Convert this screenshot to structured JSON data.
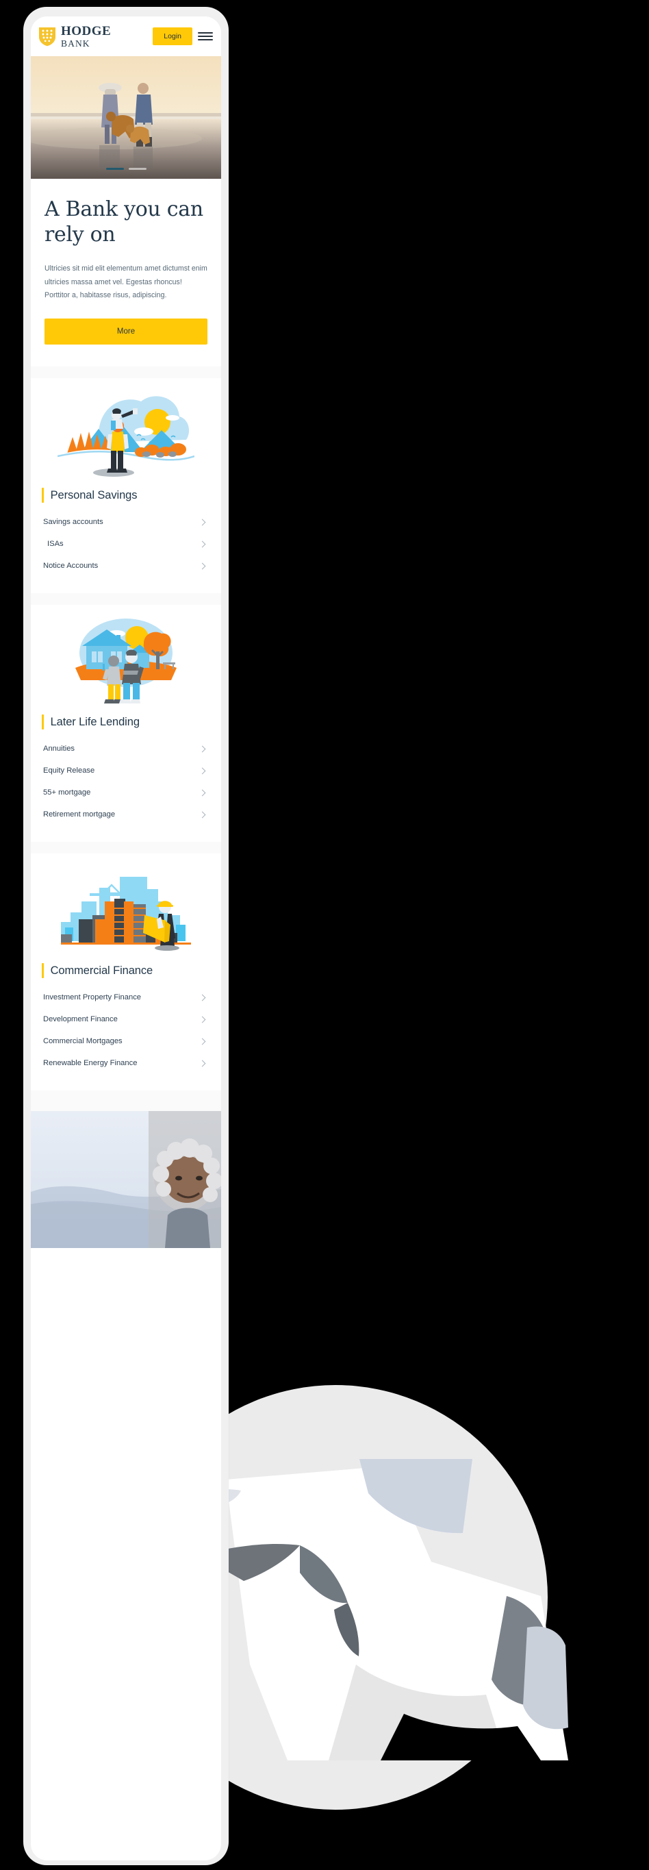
{
  "brand": {
    "name_line1": "HODGE",
    "name_line2": "BANK",
    "logo_icon": "hodge-shield-logo",
    "accent_yellow": "#ffc907",
    "ink_navy": "#23384a"
  },
  "header": {
    "login_label": "Login",
    "menu_icon": "hamburger-menu-icon"
  },
  "hero": {
    "image_alt": "beach-couple-with-dogs-at-sunset",
    "slides_total": 2,
    "active_slide": 1,
    "title": "A Bank you can rely on",
    "paragraph": "Ultricies sit mid elit elementum amet dictumst enim ultricies massa amet vel. Egestas rhoncus! Porttitor a, habitasse risus, adipiscing.",
    "cta_label": "More"
  },
  "sections": [
    {
      "id": "personal-savings",
      "title": "Personal Savings",
      "illustration": "hiker-with-child-and-telescope-illustration",
      "links": [
        {
          "label": "Savings accounts",
          "indent": false
        },
        {
          "label": "ISAs",
          "indent": true
        },
        {
          "label": "Notice Accounts",
          "indent": false
        }
      ]
    },
    {
      "id": "later-life-lending",
      "title": "Later Life Lending",
      "illustration": "couple-walking-past-house-illustration",
      "links": [
        {
          "label": "Annuities",
          "indent": false
        },
        {
          "label": "Equity Release",
          "indent": false
        },
        {
          "label": "55+ mortgage",
          "indent": false
        },
        {
          "label": "Retirement mortgage",
          "indent": false
        }
      ]
    },
    {
      "id": "commercial-finance",
      "title": "Commercial Finance",
      "illustration": "construction-site-with-architect-illustration",
      "links": [
        {
          "label": "Investment Property Finance",
          "indent": false
        },
        {
          "label": "Development Finance",
          "indent": false
        },
        {
          "label": "Commercial Mortgages",
          "indent": false
        },
        {
          "label": "Renewable Energy Finance",
          "indent": false
        }
      ]
    }
  ],
  "bottom": {
    "image_alt": "smiling-woman-with-grey-curly-hair-outdoors"
  },
  "decor": {
    "hand_icon": "pointing-hand-illustration",
    "blob_color": "#ebebec"
  }
}
